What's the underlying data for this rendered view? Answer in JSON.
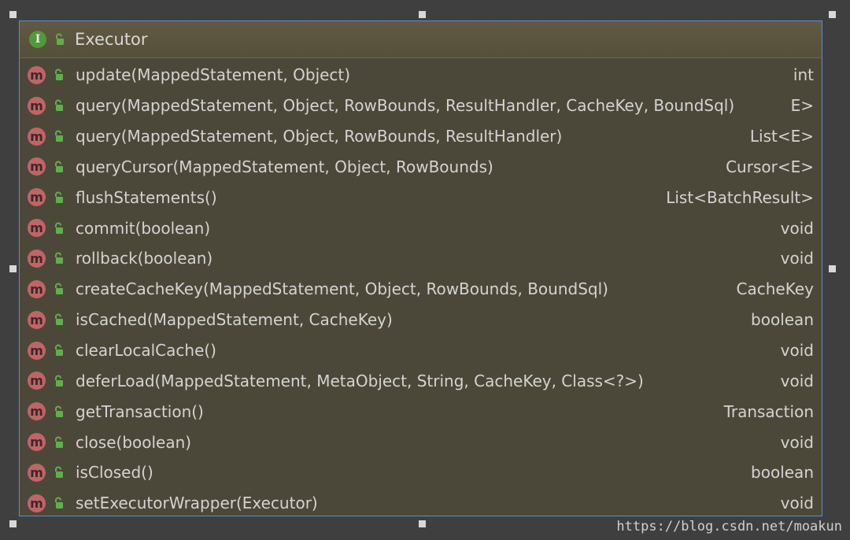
{
  "class_box": {
    "name": "Executor",
    "kind_icon": "I",
    "visibility_icon": "public-lock-icon",
    "methods": [
      {
        "signature": "update(MappedStatement, Object)",
        "return_type": "int"
      },
      {
        "signature": "query(MappedStatement, Object, RowBounds, ResultHandler, CacheKey, BoundSql)",
        "return_type": "E>"
      },
      {
        "signature": "query(MappedStatement, Object, RowBounds, ResultHandler)",
        "return_type": "List<E>"
      },
      {
        "signature": "queryCursor(MappedStatement, Object, RowBounds)",
        "return_type": "Cursor<E>"
      },
      {
        "signature": "flushStatements()",
        "return_type": "List<BatchResult>"
      },
      {
        "signature": "commit(boolean)",
        "return_type": "void"
      },
      {
        "signature": "rollback(boolean)",
        "return_type": "void"
      },
      {
        "signature": "createCacheKey(MappedStatement, Object, RowBounds, BoundSql)",
        "return_type": "CacheKey"
      },
      {
        "signature": "isCached(MappedStatement, CacheKey)",
        "return_type": "boolean"
      },
      {
        "signature": "clearLocalCache()",
        "return_type": "void"
      },
      {
        "signature": "deferLoad(MappedStatement, MetaObject, String, CacheKey, Class<?>)",
        "return_type": "void"
      },
      {
        "signature": "getTransaction()",
        "return_type": "Transaction"
      },
      {
        "signature": "close(boolean)",
        "return_type": "void"
      },
      {
        "signature": "isClosed()",
        "return_type": "boolean"
      },
      {
        "signature": "setExecutorWrapper(Executor)",
        "return_type": "void"
      }
    ]
  },
  "method_icon_letter": "m",
  "watermark": "https://blog.csdn.net/moakun",
  "colors": {
    "background": "#3f3f3f",
    "box_fill": "#4c4839",
    "box_border": "#5a8fc9",
    "method_badge": "#c06467",
    "interface_badge": "#4f9a3b",
    "lock_green": "#5fb04a",
    "text": "#d3d3d3"
  }
}
